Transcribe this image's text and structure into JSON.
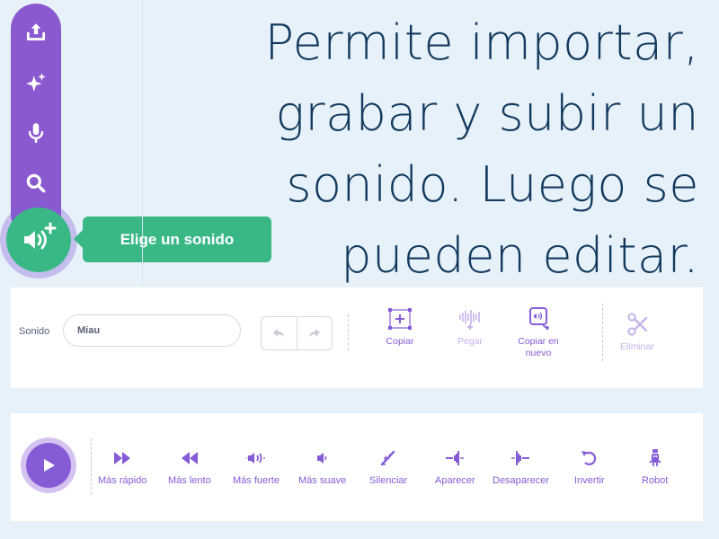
{
  "heading": {
    "line1": "Permite importar,",
    "line2": "grabar y subir un",
    "line3": "sonido. Luego se",
    "line4": "pueden editar."
  },
  "sound_menu": {
    "items": [
      {
        "icon": "upload-icon"
      },
      {
        "icon": "surprise-sparkle-icon"
      },
      {
        "icon": "microphone-icon"
      },
      {
        "icon": "search-icon"
      }
    ],
    "main_icon": "add-sound-icon",
    "tooltip": "Elige un sonido",
    "colors": {
      "menu": "#8a59cf",
      "main": "#39b886"
    }
  },
  "editor": {
    "sound_label": "Sonido",
    "sound_name": "Miau",
    "undo_icon": "undo-icon",
    "redo_icon": "redo-icon",
    "tools": [
      {
        "label": "Copiar",
        "icon": "copy-icon",
        "enabled": true
      },
      {
        "label": "Pegar",
        "icon": "paste-icon",
        "enabled": false
      },
      {
        "label": "Copiar en nuevo",
        "icon": "copy-to-new-icon",
        "enabled": true
      },
      {
        "label": "Eliminar",
        "icon": "scissors-icon",
        "enabled": false
      }
    ]
  },
  "effects": {
    "play_icon": "play-icon",
    "items": [
      {
        "label": "Más rápido",
        "icon": "faster-icon"
      },
      {
        "label": "Más lento",
        "icon": "slower-icon"
      },
      {
        "label": "Más fuerte",
        "icon": "louder-icon"
      },
      {
        "label": "Más suave",
        "icon": "softer-icon"
      },
      {
        "label": "Silenciar",
        "icon": "mute-icon"
      },
      {
        "label": "Aparecer",
        "icon": "fade-in-icon"
      },
      {
        "label": "Desaparecer",
        "icon": "fade-out-icon"
      },
      {
        "label": "Invertir",
        "icon": "reverse-icon"
      },
      {
        "label": "Robot",
        "icon": "robot-icon"
      }
    ],
    "accent": "#855cd6"
  }
}
